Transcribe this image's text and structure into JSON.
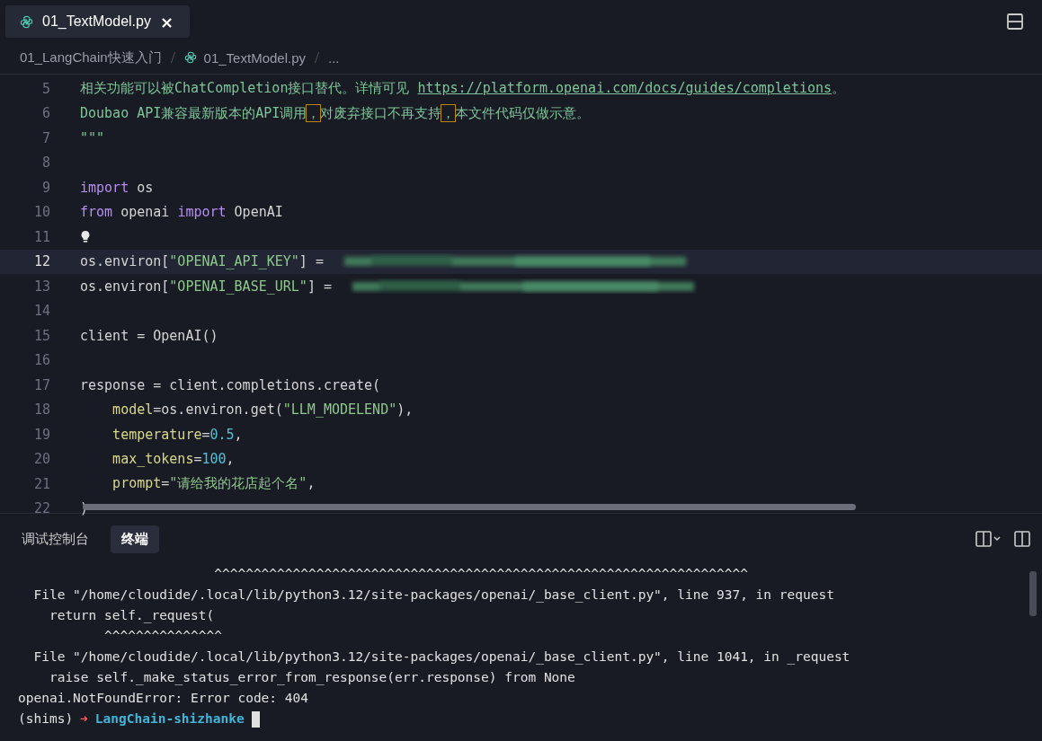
{
  "tab": {
    "label": "01_TextModel.py",
    "close": "×",
    "selected": true
  },
  "breadcrumb": [
    {
      "label": "01_LangChain快速入门",
      "kind": "folder"
    },
    {
      "label": "01_TextModel.py",
      "kind": "file"
    },
    {
      "label": "...",
      "kind": "more"
    }
  ],
  "editor": {
    "lines": [
      {
        "number": "5",
        "current": false,
        "tokens": [
          {
            "kind": "doc",
            "text": "相关功能可以被ChatCompletion接口替代。详情可见 "
          },
          {
            "kind": "link",
            "text": "https://platform.openai.com/docs/guides/completions"
          },
          {
            "kind": "doc",
            "text": "。"
          }
        ]
      },
      {
        "number": "6",
        "current": false,
        "tokens": [
          {
            "kind": "doc",
            "text": "Doubao API兼容最新版本的API调用"
          },
          {
            "kind": "warn",
            "text": "，"
          },
          {
            "kind": "doc",
            "text": "对废弃接口不再支持"
          },
          {
            "kind": "warn",
            "text": "，"
          },
          {
            "kind": "doc",
            "text": "本文件代码仅做示意。"
          }
        ]
      },
      {
        "number": "7",
        "current": false,
        "tokens": [
          {
            "kind": "doc",
            "text": "\"\"\""
          }
        ]
      },
      {
        "number": "8",
        "current": false
      },
      {
        "number": "9",
        "current": false,
        "tokens": [
          {
            "kind": "kw",
            "text": "import"
          },
          {
            "kind": "plain",
            "text": " os"
          }
        ]
      },
      {
        "number": "10",
        "current": false,
        "tokens": [
          {
            "kind": "kw",
            "text": "from"
          },
          {
            "kind": "plain",
            "text": " openai "
          },
          {
            "kind": "kw",
            "text": "import"
          },
          {
            "kind": "plain",
            "text": " OpenAI"
          }
        ]
      },
      {
        "number": "11",
        "current": false,
        "tokens": [
          {
            "kind": "bulb"
          }
        ]
      },
      {
        "number": "12",
        "current": true,
        "tokens": [
          {
            "kind": "plain",
            "text": "os.environ["
          },
          {
            "kind": "str",
            "text": "\"OPENAI_API_KEY\""
          },
          {
            "kind": "plain",
            "text": "] = "
          },
          {
            "kind": "redacted"
          }
        ]
      },
      {
        "number": "13",
        "current": false,
        "tokens": [
          {
            "kind": "plain",
            "text": "os.environ["
          },
          {
            "kind": "str",
            "text": "\"OPENAI_BASE_URL\""
          },
          {
            "kind": "plain",
            "text": "] = "
          },
          {
            "kind": "redacted"
          }
        ]
      },
      {
        "number": "14",
        "current": false
      },
      {
        "number": "15",
        "current": false,
        "tokens": [
          {
            "kind": "plain",
            "text": "client = OpenAI()"
          }
        ]
      },
      {
        "number": "16",
        "current": false
      },
      {
        "number": "17",
        "current": false,
        "tokens": [
          {
            "kind": "plain",
            "text": "response = client.completions.create("
          }
        ]
      },
      {
        "number": "18",
        "current": false,
        "tokens": [
          {
            "kind": "indent"
          },
          {
            "kind": "param",
            "text": "model"
          },
          {
            "kind": "plain",
            "text": "=os.environ.get("
          },
          {
            "kind": "str",
            "text": "\"LLM_MODELEND\""
          },
          {
            "kind": "plain",
            "text": "),"
          }
        ]
      },
      {
        "number": "19",
        "current": false,
        "tokens": [
          {
            "kind": "indent"
          },
          {
            "kind": "param",
            "text": "temperature"
          },
          {
            "kind": "plain",
            "text": "="
          },
          {
            "kind": "num",
            "text": "0.5"
          },
          {
            "kind": "plain",
            "text": ","
          }
        ]
      },
      {
        "number": "20",
        "current": false,
        "tokens": [
          {
            "kind": "indent"
          },
          {
            "kind": "param",
            "text": "max_tokens"
          },
          {
            "kind": "plain",
            "text": "="
          },
          {
            "kind": "num",
            "text": "100"
          },
          {
            "kind": "plain",
            "text": ","
          }
        ]
      },
      {
        "number": "21",
        "current": false,
        "tokens": [
          {
            "kind": "indent"
          },
          {
            "kind": "param",
            "text": "prompt"
          },
          {
            "kind": "plain",
            "text": "="
          },
          {
            "kind": "str",
            "text": "\"请给我的花店起个名\""
          },
          {
            "kind": "plain",
            "text": ","
          }
        ]
      },
      {
        "number": "22",
        "current": false,
        "tokens": [
          {
            "kind": "plain",
            "text": ")"
          }
        ]
      }
    ]
  },
  "panel": {
    "tabs": [
      {
        "label": "调试控制台",
        "selected": false
      },
      {
        "label": "终端",
        "selected": true
      }
    ]
  },
  "terminal": {
    "lines": [
      "                         ^^^^^^^^^^^^^^^^^^^^^^^^^^^^^^^^^^^^^^^^^^^^^^^^^^^^^^^^^^^^^^^^^^^^",
      "  File \"/home/cloudide/.local/lib/python3.12/site-packages/openai/_base_client.py\", line 937, in request",
      "    return self._request(",
      "           ^^^^^^^^^^^^^^^",
      "  File \"/home/cloudide/.local/lib/python3.12/site-packages/openai/_base_client.py\", line 1041, in _request",
      "    raise self._make_status_error_from_response(err.response) from None",
      "openai.NotFoundError: Error code: 404"
    ],
    "prompt": {
      "env": "(shims)",
      "arrow": "➜",
      "dir": "LangChain-shizhanke"
    }
  }
}
